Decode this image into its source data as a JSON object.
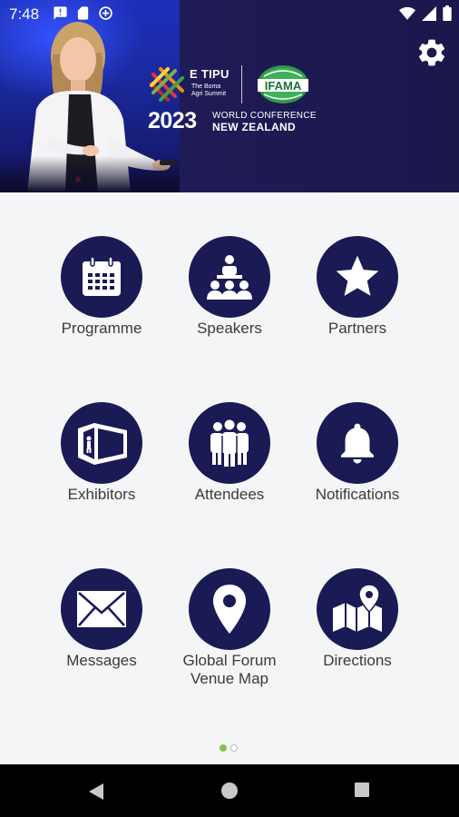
{
  "status_bar": {
    "time": "7:48",
    "icons_left": [
      "message-icon",
      "sim-card-icon",
      "data-saver-icon"
    ],
    "icons_right": [
      "wifi-icon",
      "signal-icon",
      "battery-icon"
    ]
  },
  "banner": {
    "etipu_title": "E TIPU",
    "etipu_subtitle": "The Boma Agri Summit",
    "ifama_label": "IFAMA",
    "year": "2023",
    "conference_line1": "WORLD CONFERENCE",
    "conference_line2": "NEW ZEALAND",
    "settings_icon": "gear-icon"
  },
  "tiles": [
    {
      "label": "Programme",
      "icon": "calendar-icon"
    },
    {
      "label": "Speakers",
      "icon": "speakers-icon"
    },
    {
      "label": "Partners",
      "icon": "star-icon"
    },
    {
      "label": "Exhibitors",
      "icon": "exhibitor-booth-icon"
    },
    {
      "label": "Attendees",
      "icon": "people-group-icon"
    },
    {
      "label": "Notifications",
      "icon": "bell-icon"
    },
    {
      "label": "Messages",
      "icon": "envelope-icon"
    },
    {
      "label": "Global Forum\nVenue Map",
      "icon": "map-pin-icon"
    },
    {
      "label": "Directions",
      "icon": "map-directions-icon"
    }
  ],
  "pager": {
    "total": 2,
    "active": 1
  },
  "colors": {
    "banner_bg": "#1d1a58",
    "circle_bg": "#1a1a55",
    "page_bg": "#f4f5f6",
    "pager_active": "#8bc34a",
    "pager_inactive": "#ffffff"
  },
  "nav_bar": {
    "buttons": [
      "back-icon",
      "home-icon",
      "recents-icon"
    ]
  }
}
